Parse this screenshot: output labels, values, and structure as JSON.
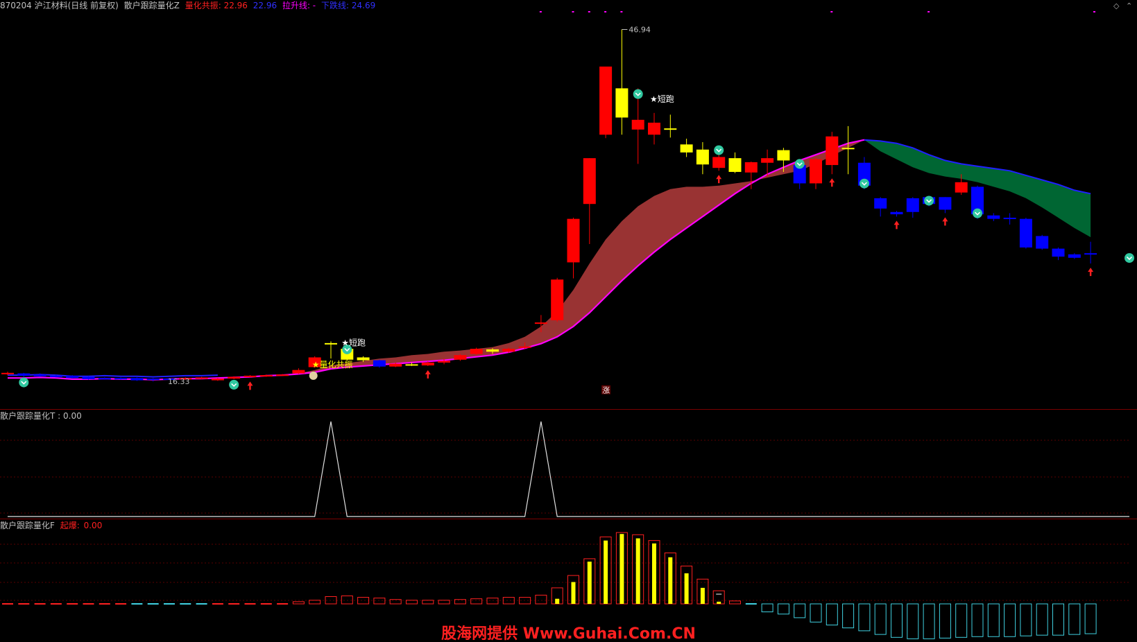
{
  "header": {
    "code_name": "870204 沪江材料(日线 前复权)",
    "indicator_main": "散户跟踪量化Z",
    "label_resonance": "量化共振:",
    "value_resonance": "22.96",
    "value_extra": "22.96",
    "label_lift": "拉升线: -",
    "label_down": "下跌线:",
    "value_down": "24.69"
  },
  "pane_t": {
    "title": "散户跟踪量化T",
    "value": ": 0.00"
  },
  "pane_f": {
    "title": "散户跟踪量化F",
    "label": "起爆:",
    "value": "0.00"
  },
  "annotations": {
    "high_price": "46.94",
    "low_price": "16.33",
    "short_run_1": "★短跑",
    "short_run_2": "★短跑",
    "resonance": "★量化共振",
    "limit_up": "涨"
  },
  "corner_icons": [
    "diamond-icon",
    "chevron-up-icon"
  ],
  "watermark": "股海网提供 Www.Guhai.Com.CN",
  "colors": {
    "up": "#ff0000",
    "down": "#0000ff",
    "special": "#ffff00",
    "lift_line": "#ff00ff",
    "band_red": "#993333",
    "band_green": "#006633"
  },
  "chart_data": {
    "type": "candlestick",
    "ylim": [
      15,
      48
    ],
    "candles": [
      [
        0,
        "r",
        16.85,
        16.95,
        17.05,
        16.75
      ],
      [
        1,
        "b",
        16.9,
        16.7,
        16.95,
        16.6
      ],
      [
        2,
        "b",
        16.8,
        16.65,
        16.9,
        16.6
      ],
      [
        3,
        "b",
        16.7,
        16.6,
        16.8,
        16.55
      ],
      [
        4,
        "b",
        16.7,
        16.5,
        16.75,
        16.45
      ],
      [
        5,
        "b",
        16.6,
        16.4,
        16.65,
        16.35
      ],
      [
        6,
        "b",
        16.5,
        16.45,
        16.55,
        16.4
      ],
      [
        7,
        "b",
        16.5,
        16.4,
        16.55,
        16.35
      ],
      [
        8,
        "b",
        16.5,
        16.3,
        16.55,
        16.25
      ],
      [
        9,
        "b",
        16.45,
        16.35,
        16.5,
        16.2
      ],
      [
        10,
        "b",
        16.45,
        16.35,
        16.5,
        16.33
      ],
      [
        11,
        "r",
        16.4,
        16.5,
        16.55,
        16.35
      ],
      [
        12,
        "r",
        16.45,
        16.55,
        16.6,
        16.4
      ],
      [
        13,
        "r",
        16.3,
        16.45,
        16.5,
        16.25
      ],
      [
        14,
        "r",
        16.45,
        16.6,
        16.65,
        16.4
      ],
      [
        15,
        "r",
        16.6,
        16.7,
        16.75,
        16.55
      ],
      [
        16,
        "r",
        16.65,
        16.75,
        16.8,
        16.6
      ],
      [
        17,
        "r",
        16.75,
        16.8,
        16.85,
        16.7
      ],
      [
        18,
        "r",
        16.9,
        17.2,
        17.35,
        16.85
      ],
      [
        19,
        "r",
        17.45,
        18.3,
        18.4,
        17.4
      ],
      [
        20,
        "y",
        19.55,
        19.5,
        19.7,
        18.2
      ],
      [
        21,
        "y",
        18.1,
        19.05,
        19.3,
        18.0
      ],
      [
        22,
        "y",
        18.3,
        18.05,
        18.4,
        17.9
      ],
      [
        23,
        "b",
        18.05,
        17.5,
        18.1,
        17.4
      ],
      [
        24,
        "r",
        17.5,
        17.75,
        17.85,
        17.45
      ],
      [
        25,
        "y",
        17.7,
        17.65,
        17.85,
        17.55
      ],
      [
        26,
        "r",
        17.6,
        17.85,
        17.95,
        17.55
      ],
      [
        27,
        "r",
        17.85,
        18.0,
        18.2,
        17.7
      ],
      [
        28,
        "r",
        18.1,
        18.5,
        18.6,
        18.0
      ],
      [
        29,
        "r",
        18.6,
        19.05,
        19.15,
        18.5
      ],
      [
        30,
        "y",
        19.0,
        18.8,
        19.1,
        18.6
      ],
      [
        31,
        "r",
        18.8,
        19.05,
        19.15,
        18.7
      ],
      [
        32,
        "r",
        19.2,
        19.25,
        19.6,
        19.05
      ],
      [
        33,
        "r",
        21.25,
        21.35,
        22.0,
        20.5
      ],
      [
        34,
        "r",
        21.55,
        25.1,
        25.25,
        21.4
      ],
      [
        35,
        "r",
        26.6,
        30.4,
        30.5,
        25.2
      ],
      [
        36,
        "r",
        31.7,
        35.7,
        35.7,
        28.2
      ],
      [
        37,
        "r",
        37.75,
        43.7,
        43.7,
        37.45
      ],
      [
        38,
        "y",
        41.8,
        39.25,
        46.94,
        37.75
      ],
      [
        39,
        "r",
        38.2,
        39.05,
        41.8,
        35.2
      ],
      [
        40,
        "r",
        37.75,
        38.8,
        39.65,
        36.9
      ],
      [
        41,
        "y",
        38.3,
        38.25,
        39.5,
        37.5
      ],
      [
        42,
        "y",
        36.9,
        36.2,
        37.4,
        35.8
      ],
      [
        43,
        "y",
        36.45,
        35.15,
        37.1,
        34.3
      ],
      [
        44,
        "r",
        34.85,
        35.8,
        36.25,
        34.6
      ],
      [
        45,
        "y",
        35.7,
        34.5,
        36.2,
        34.4
      ],
      [
        46,
        "r",
        34.45,
        35.35,
        35.4,
        33.0
      ],
      [
        47,
        "r",
        35.3,
        35.7,
        36.45,
        34.1
      ],
      [
        48,
        "y",
        36.4,
        35.5,
        36.6,
        34.5
      ],
      [
        49,
        "b",
        35.1,
        33.5,
        35.4,
        33.0
      ],
      [
        50,
        "r",
        33.5,
        35.6,
        35.7,
        33.0
      ],
      [
        51,
        "r",
        35.1,
        37.6,
        38.0,
        34.3
      ],
      [
        52,
        "y",
        36.6,
        36.5,
        38.5,
        34.3
      ],
      [
        53,
        "b",
        35.3,
        33.3,
        35.8,
        33.0
      ],
      [
        54,
        "b",
        32.2,
        31.3,
        32.3,
        30.6
      ],
      [
        55,
        "b",
        31.0,
        30.8,
        31.1,
        30.6
      ],
      [
        56,
        "b",
        32.2,
        31.0,
        32.3,
        30.5
      ],
      [
        57,
        "b",
        32.3,
        31.7,
        32.3,
        31.5
      ],
      [
        58,
        "b",
        32.3,
        31.2,
        32.3,
        30.9
      ],
      [
        59,
        "r",
        32.7,
        33.6,
        34.3,
        32.5
      ],
      [
        60,
        "b",
        33.2,
        30.8,
        33.3,
        30.4
      ],
      [
        61,
        "b",
        30.7,
        30.4,
        30.9,
        30.2
      ],
      [
        62,
        "b",
        30.5,
        30.4,
        30.9,
        29.9
      ],
      [
        63,
        "b",
        30.4,
        27.9,
        30.5,
        27.8
      ],
      [
        64,
        "b",
        28.9,
        27.8,
        29.0,
        27.7
      ],
      [
        65,
        "b",
        27.8,
        27.1,
        27.9,
        26.8
      ],
      [
        66,
        "b",
        27.3,
        27.0,
        27.4,
        26.9
      ],
      [
        67,
        "b",
        27.4,
        27.3,
        28.4,
        26.5
      ]
    ],
    "lift_line": [
      16.5,
      16.5,
      16.55,
      16.5,
      16.4,
      16.4,
      16.45,
      16.4,
      16.4,
      16.35,
      16.4,
      16.45,
      16.45,
      16.5,
      16.55,
      16.6,
      16.7,
      16.75,
      16.85,
      17.0,
      17.3,
      17.45,
      17.55,
      17.65,
      17.75,
      17.85,
      17.95,
      18.05,
      18.2,
      18.35,
      18.5,
      18.75,
      19.1,
      19.5,
      20.1,
      21.0,
      22.2,
      23.6,
      25.0,
      26.3,
      27.5,
      28.6,
      29.6,
      30.6,
      31.6,
      32.6,
      33.5,
      34.3,
      34.9,
      35.5,
      36.0,
      36.5,
      37.0,
      37.3
    ],
    "band_top": [
      16.5,
      16.5,
      16.55,
      16.5,
      16.4,
      16.4,
      16.45,
      16.4,
      16.4,
      16.35,
      16.4,
      16.45,
      16.45,
      16.5,
      16.55,
      16.6,
      16.7,
      16.75,
      16.9,
      17.2,
      17.6,
      17.8,
      18.0,
      18.2,
      18.3,
      18.5,
      18.6,
      18.8,
      18.9,
      19.05,
      19.2,
      19.55,
      20.1,
      21.0,
      22.3,
      24.2,
      26.5,
      28.6,
      30.2,
      31.5,
      32.4,
      33.0,
      33.2,
      33.2,
      33.3,
      33.5,
      33.7,
      34.0,
      34.3,
      34.6,
      35.2,
      35.9,
      36.6,
      37.3
    ],
    "green_top": [
      37.3,
      37.2,
      37.0,
      36.6,
      36.0,
      35.5,
      35.2,
      35.0,
      34.8,
      34.6,
      34.2,
      33.8,
      33.4,
      32.9,
      32.6
    ],
    "green_bot": [
      37.3,
      36.3,
      35.6,
      34.9,
      34.4,
      34.1,
      33.9,
      33.6,
      33.2,
      32.8,
      32.2,
      31.4,
      30.5,
      29.6,
      28.8
    ],
    "t_series": [
      0,
      0,
      0,
      0,
      0,
      0,
      0,
      0,
      0,
      0,
      0,
      0,
      0,
      0,
      0,
      0,
      0,
      0,
      0,
      0,
      1,
      0,
      0,
      0,
      0,
      0,
      0,
      0,
      0,
      0,
      0,
      0,
      0,
      1,
      0,
      0,
      0,
      0,
      0,
      0,
      0,
      0,
      0,
      0,
      0,
      0,
      0,
      0,
      0,
      0,
      0,
      0,
      0,
      0,
      0,
      0,
      0,
      0,
      0,
      0,
      0,
      0,
      0,
      0,
      0,
      0,
      0,
      0
    ],
    "f_series": [
      -0.3,
      -0.3,
      -0.3,
      -0.4,
      -0.4,
      -0.4,
      -0.4,
      -0.4,
      -0.5,
      -0.5,
      -0.6,
      -0.6,
      -0.6,
      -0.4,
      -0.4,
      -0.3,
      -0.3,
      -0.3,
      0.3,
      0.5,
      1.0,
      1.1,
      0.9,
      0.8,
      0.6,
      0.5,
      0.5,
      0.5,
      0.6,
      0.7,
      0.8,
      0.9,
      0.9,
      1.2,
      2.2,
      3.9,
      6.2,
      9.2,
      9.8,
      9.5,
      8.7,
      7.0,
      5.2,
      3.4,
      1.8,
      0.4,
      -0.6,
      -1.1,
      -1.4,
      -1.9,
      -2.5,
      -2.9,
      -3.3,
      -3.7,
      -4.2,
      -4.6,
      -4.8,
      -4.8,
      -4.7,
      -4.6,
      -4.5,
      -4.5,
      -4.5,
      -4.4,
      -4.3,
      -4.3,
      -4.2,
      -4.1
    ],
    "f_inner": [
      0,
      0,
      0,
      0,
      0,
      0,
      0,
      0,
      0,
      0,
      0,
      0,
      0,
      0,
      0,
      0,
      0,
      0,
      0,
      0,
      0,
      0,
      0,
      0,
      0,
      0,
      0,
      0,
      0,
      0,
      0,
      0,
      0,
      0,
      0.7,
      3.0,
      5.8,
      8.7,
      9.6,
      9.0,
      8.3,
      6.4,
      4.2,
      2.2,
      0.3,
      0,
      0,
      0,
      0,
      0,
      0,
      0,
      0,
      0,
      0,
      0,
      0,
      0,
      0,
      0,
      0,
      0,
      0,
      0,
      0,
      0,
      0,
      0
    ]
  }
}
